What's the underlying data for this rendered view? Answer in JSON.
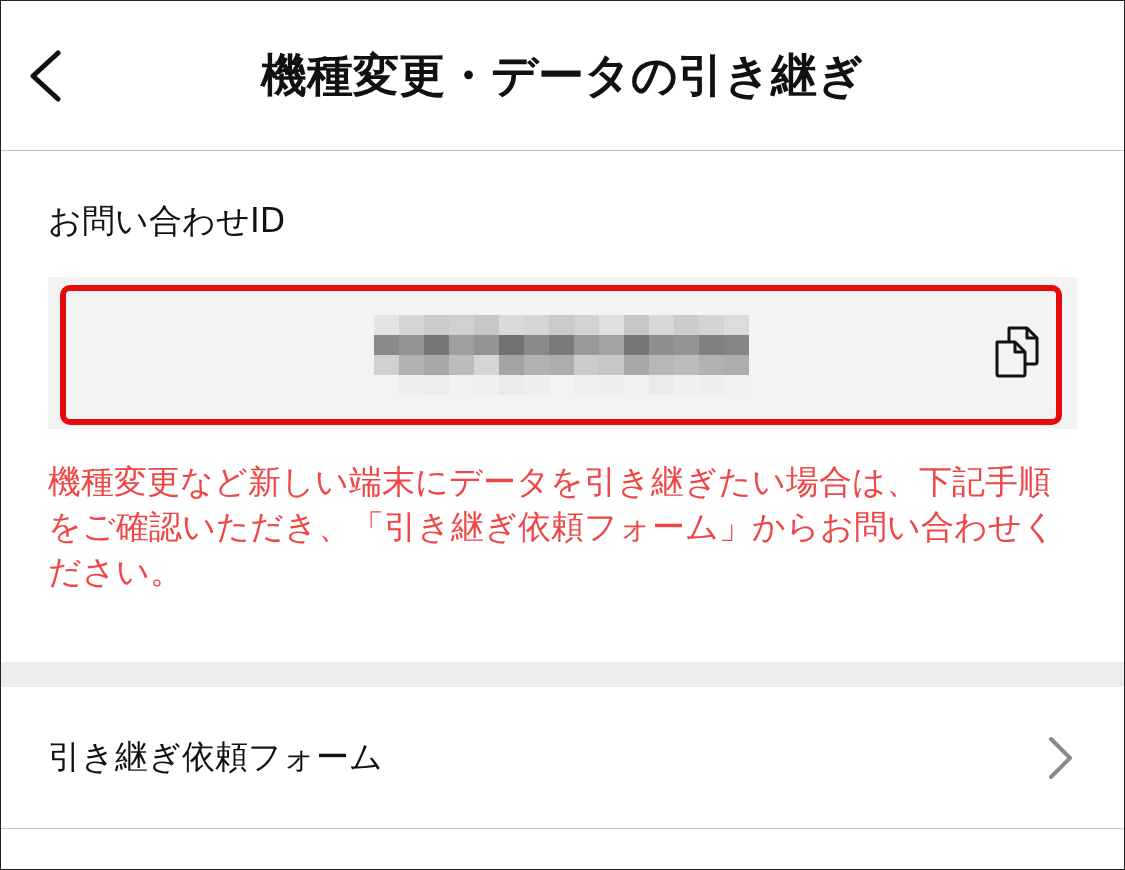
{
  "header": {
    "title": "機種変更・データの引き継ぎ"
  },
  "id_section": {
    "label": "お問い合わせID",
    "highlighted": true,
    "notice": "機種変更など新しい端末にデータを引き継ぎたい場合は、下記手順をご確認いただき、「引き継ぎ依頼フォーム」からお問い合わせください。"
  },
  "menu": [
    {
      "label": "引き継ぎ依頼フォーム"
    }
  ]
}
